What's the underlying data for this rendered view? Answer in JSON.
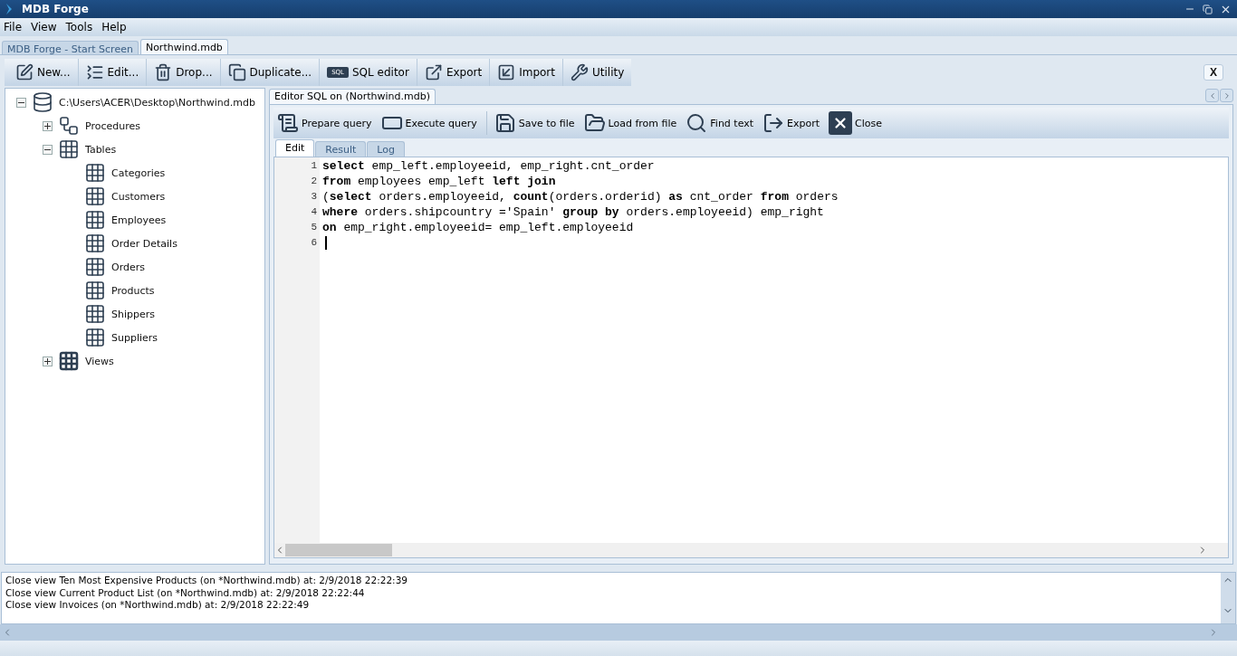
{
  "window": {
    "title": "MDB Forge"
  },
  "menu": [
    "File",
    "View",
    "Tools",
    "Help"
  ],
  "doc_tabs": [
    {
      "label": "MDB Forge - Start Screen",
      "selected": false
    },
    {
      "label": "Northwind.mdb",
      "selected": true
    }
  ],
  "toolbar": [
    {
      "label": "New..."
    },
    {
      "label": "Edit..."
    },
    {
      "label": "Drop..."
    },
    {
      "label": "Duplicate..."
    },
    {
      "label": "SQL editor",
      "badge": "SQL"
    },
    {
      "label": "Export"
    },
    {
      "label": "Import"
    },
    {
      "label": "Utility"
    }
  ],
  "close_all": "X",
  "tree": {
    "label": "C:\\Users\\ACER\\Desktop\\Northwind.mdb",
    "expanded": true,
    "kind": "database",
    "children": [
      {
        "label": "Procedures",
        "expanded": false,
        "kind": "procedures"
      },
      {
        "label": "Tables",
        "expanded": true,
        "kind": "tables",
        "children": [
          {
            "label": "Categories",
            "kind": "table"
          },
          {
            "label": "Customers",
            "kind": "table"
          },
          {
            "label": "Employees",
            "kind": "table"
          },
          {
            "label": "Order Details",
            "kind": "table"
          },
          {
            "label": "Orders",
            "kind": "table"
          },
          {
            "label": "Products",
            "kind": "table"
          },
          {
            "label": "Shippers",
            "kind": "table"
          },
          {
            "label": "Suppliers",
            "kind": "table"
          }
        ]
      },
      {
        "label": "Views",
        "expanded": false,
        "kind": "views"
      }
    ]
  },
  "editor_tabs": [
    {
      "label": "Editor SQL on (Northwind.mdb)",
      "selected": true
    }
  ],
  "editor_toolbar": [
    "Prepare query",
    "Execute query",
    "Save to file",
    "Load from file",
    "Find text",
    "Export",
    "Close"
  ],
  "sub_tabs": [
    {
      "label": "Edit",
      "selected": true
    },
    {
      "label": "Result",
      "selected": false
    },
    {
      "label": "Log",
      "selected": false
    }
  ],
  "code_lines": [
    {
      "number": "1",
      "text": "**select** emp_left.employeeid, emp_right.cnt_order"
    },
    {
      "number": "2",
      "text": "**from** employees emp_left **left join**"
    },
    {
      "number": "3",
      "text": "(**select** orders.employeeid, **count**(orders.orderid) **as** cnt_order **from** orders"
    },
    {
      "number": "4",
      "text": "**where** orders.shipcountry ='Spain' **group by** orders.employeeid) emp_right"
    },
    {
      "number": "5",
      "text": "**on** emp_right.employeeid= emp_left.employeeid"
    },
    {
      "number": "6",
      "cursor": true
    }
  ],
  "log": [
    "Close view Ten Most Expensive Products (on *Northwind.mdb) at: 2/9/2018 22:22:39",
    "Close view Current Product List (on *Northwind.mdb) at: 2/9/2018 22:22:44",
    "Close view Invoices (on *Northwind.mdb) at: 2/9/2018 22:22:49"
  ]
}
